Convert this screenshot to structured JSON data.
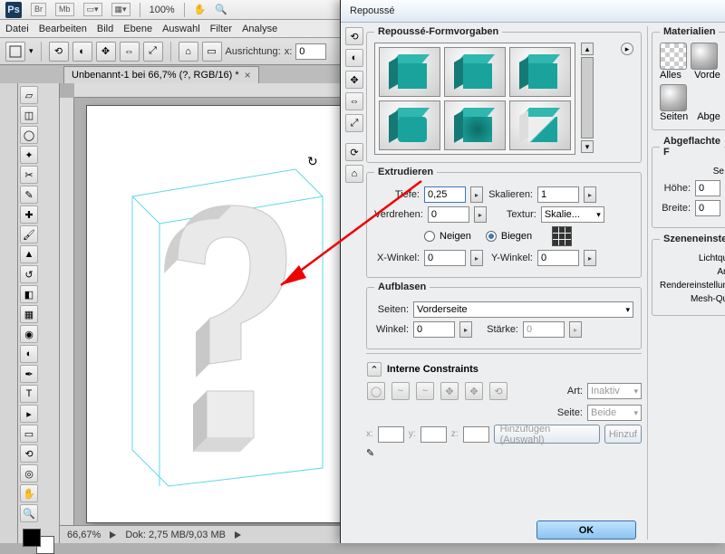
{
  "app": {
    "logo": "Ps",
    "br": "Br",
    "mb": "Mb",
    "zoom_top": "100%"
  },
  "menu": {
    "items": [
      "Datei",
      "Bearbeiten",
      "Bild",
      "Ebene",
      "Auswahl",
      "Filter",
      "Analyse"
    ]
  },
  "optionsbar": {
    "align_label": "Ausrichtung:",
    "x_label": "x:",
    "x_val": "0"
  },
  "doc_tab": {
    "title": "Unbenannt-1 bei 66,7% (?, RGB/16) *"
  },
  "status": {
    "zoom": "66,67%",
    "doc": "Dok: 2,75 MB/9,03 MB"
  },
  "dialog": {
    "title": "Repoussé",
    "presets_legend": "Repoussé-Formvorgaben",
    "extrude": {
      "legend": "Extrudieren",
      "depth_label": "Tiefe:",
      "depth_val": "0,25",
      "scale_label": "Skalieren:",
      "scale_val": "1",
      "twist_label": "Verdrehen:",
      "twist_val": "0",
      "texture_label": "Textur:",
      "texture_val": "Skalie...",
      "neigen": "Neigen",
      "biegen": "Biegen",
      "xang_label": "X-Winkel:",
      "xang_val": "0",
      "yang_label": "Y-Winkel:",
      "yang_val": "0"
    },
    "inflate": {
      "legend": "Aufblasen",
      "sides_label": "Seiten:",
      "sides_val": "Vorderseite",
      "angle_label": "Winkel:",
      "angle_val": "0",
      "strength_label": "Stärke:",
      "strength_val": "0"
    },
    "constraints": {
      "legend": "Interne Constraints",
      "type_label": "Art:",
      "type_val": "Inaktiv",
      "side_label": "Seite:",
      "side_val": "Beide",
      "x": "x:",
      "y": "y:",
      "z": "z:",
      "add_sel": "Hinzufügen (Auswahl)",
      "add": "Hinzuf"
    },
    "materials": {
      "legend": "Materialien",
      "alles": "Alles",
      "vorder": "Vorde",
      "seiten": "Seiten",
      "abge": "Abge"
    },
    "bevel": {
      "legend": "Abgeflachte F",
      "se": "Se",
      "h_label": "Höhe:",
      "h_val": "0",
      "b_label": "Breite:",
      "b_val": "0"
    },
    "scene": {
      "legend": "Szeneneinste",
      "l1": "Lichtque",
      "l2": "Ans",
      "l3": "Rendereinstellung",
      "l4": "Mesh-Qua"
    },
    "ok": "OK"
  }
}
